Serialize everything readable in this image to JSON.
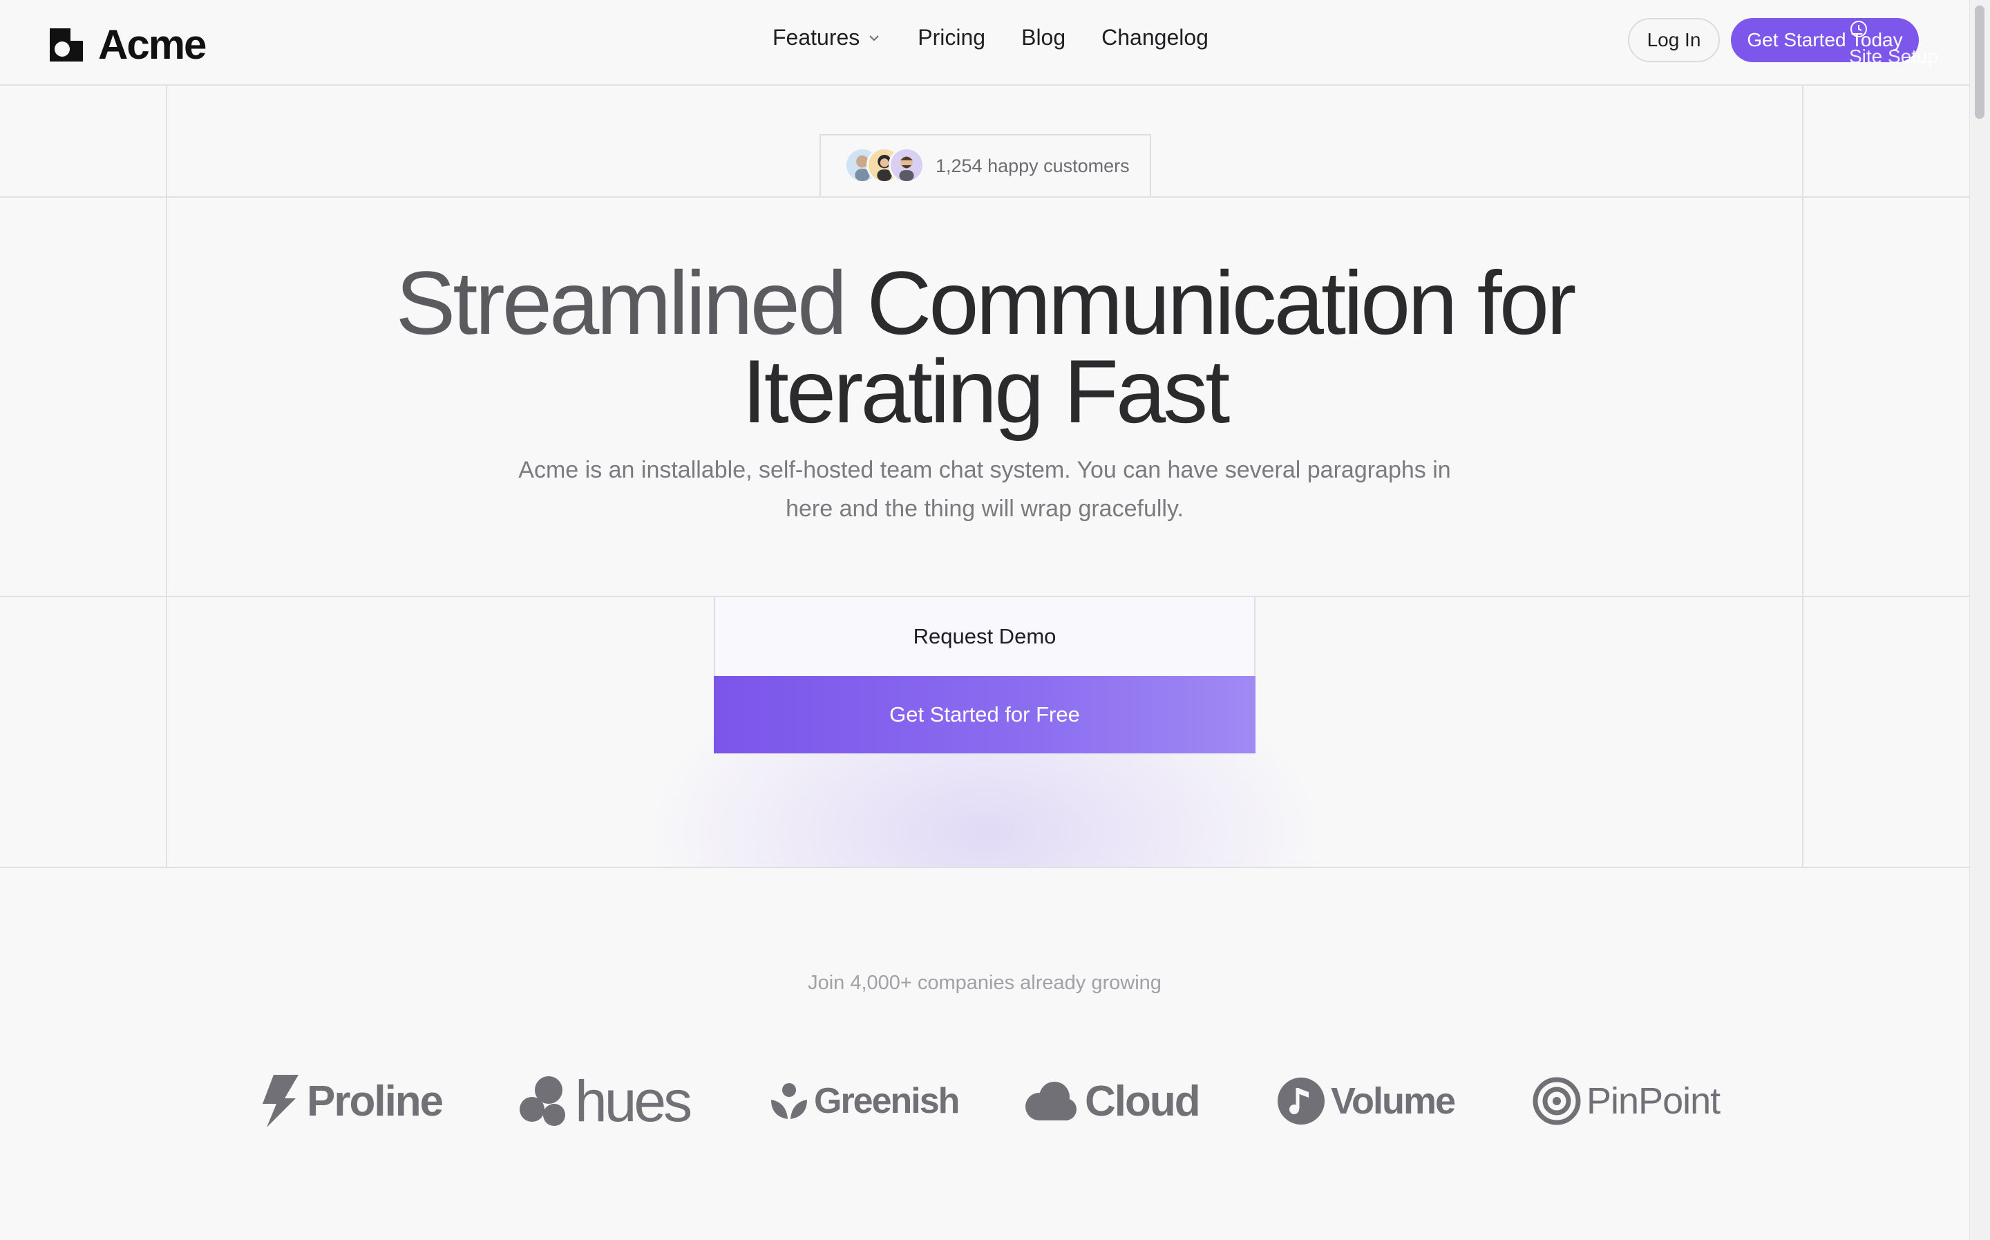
{
  "header": {
    "brand": "Acme",
    "nav": [
      {
        "label": "Features",
        "has_dropdown": true
      },
      {
        "label": "Pricing"
      },
      {
        "label": "Blog"
      },
      {
        "label": "Changelog"
      }
    ],
    "login_label": "Log In",
    "cta_label": "Get Started Today",
    "overlay_label": "Site Setup"
  },
  "hero": {
    "badge_text": "1,254 happy customers",
    "headline_line1_a": "Streamlined",
    "headline_line1_b": "Communication for",
    "headline_line2": "Iterating Fast",
    "subtitle": "Acme is an installable, self-hosted team chat system. You can have several paragraphs in here and the thing will wrap gracefully.",
    "demo_label": "Request Demo",
    "free_label": "Get Started for Free"
  },
  "social_proof": {
    "heading": "Join 4,000+ companies already growing",
    "brands": [
      "Proline",
      "hues",
      "Greenish",
      "Cloud",
      "Volume",
      "PinPoint"
    ]
  },
  "colors": {
    "accent": "#7d57ec",
    "text": "#1d1d1f",
    "muted": "#7a7a80",
    "grid_line": "#e0e0e3",
    "background": "#f8f8f9"
  }
}
